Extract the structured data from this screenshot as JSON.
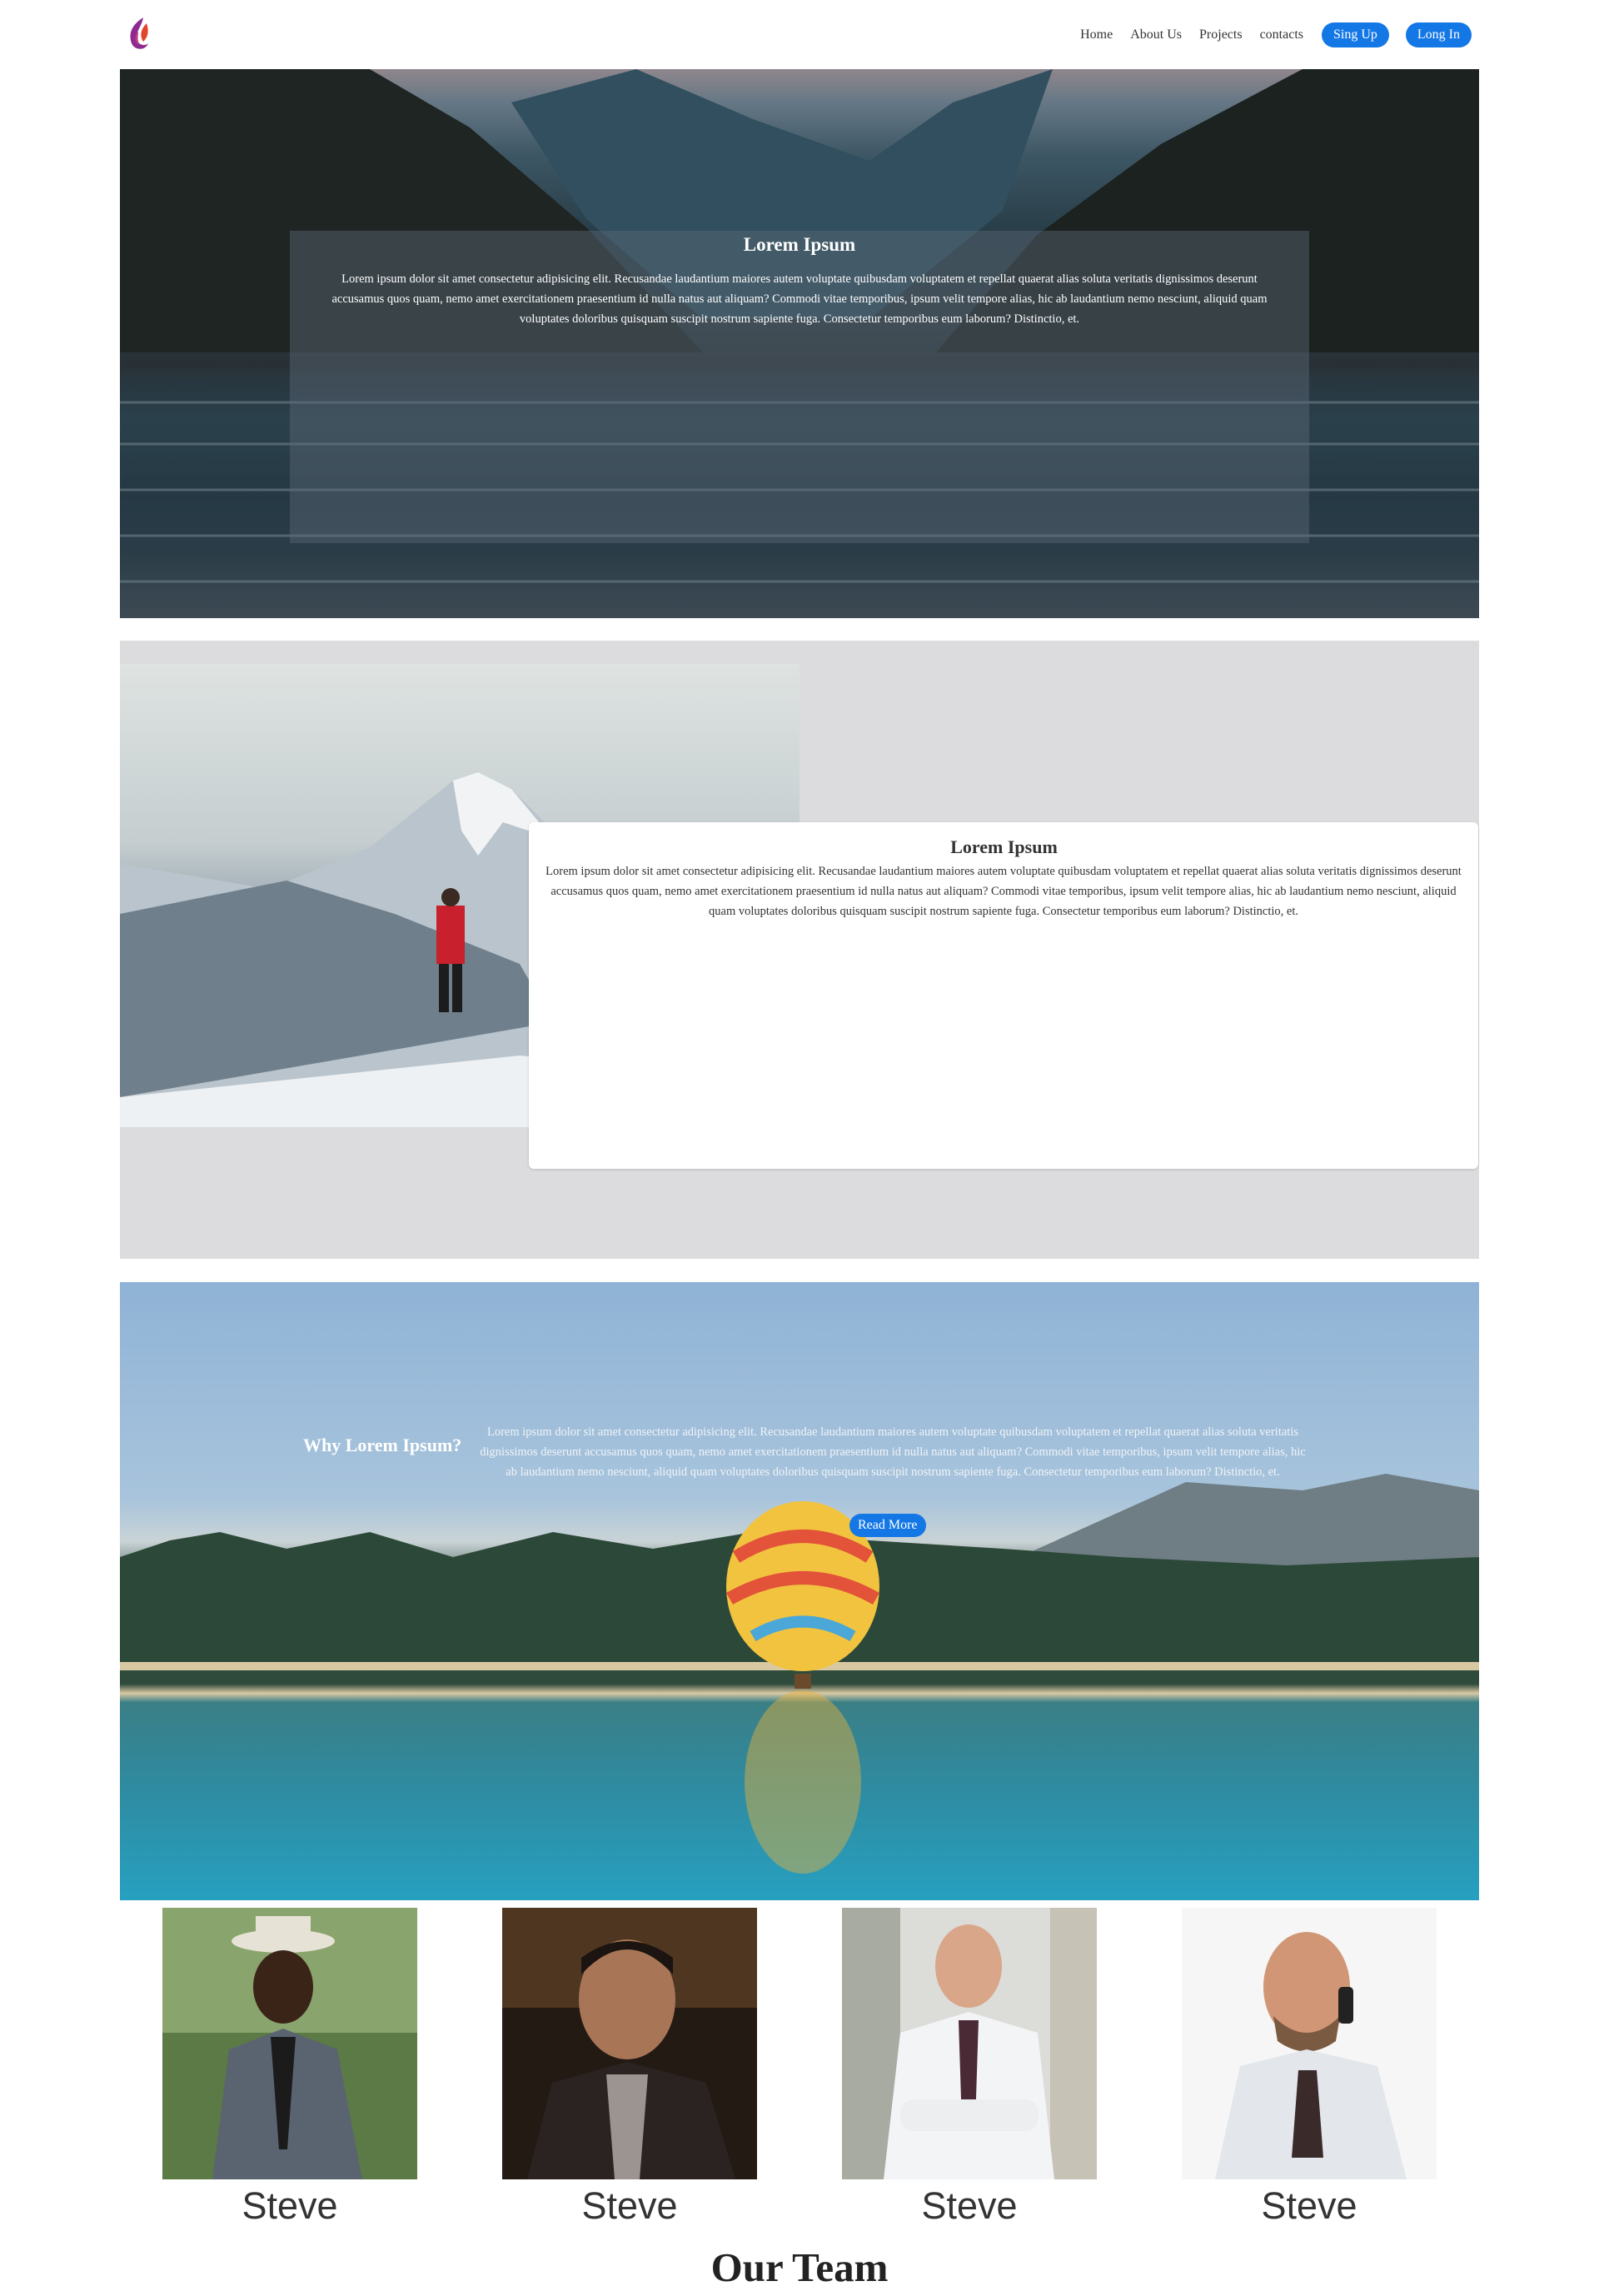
{
  "nav": {
    "logo_icon": "flame-logo-icon",
    "links": [
      "Home",
      "About Us",
      "Projects",
      "contacts"
    ],
    "signup_label": "Sing Up",
    "login_label": "Long In",
    "accent_color": "#1477e6"
  },
  "hero": {
    "title": "Lorem Ipsum",
    "text": "Lorem ipsum dolor sit amet consectetur adipisicing elit. Recusandae laudantium maiores autem voluptate quibusdam voluptatem et repellat quaerat alias soluta veritatis dignissimos deserunt accusamus quos quam, nemo amet exercitationem praesentium id nulla natus aut aliquam? Commodi vitae temporibus, ipsum velit tempore alias, hic ab laudantium nemo nesciunt, aliquid quam voluptates doloribus quisquam suscipit nostrum sapiente fuga. Consectetur temporibus eum laborum? Distinctio, et."
  },
  "about": {
    "title": "Lorem Ipsum",
    "text": "Lorem ipsum dolor sit amet consectetur adipisicing elit. Recusandae laudantium maiores autem voluptate quibusdam voluptatem et repellat quaerat alias soluta veritatis dignissimos deserunt accusamus quos quam, nemo amet exercitationem praesentium id nulla natus aut aliquam? Commodi vitae temporibus, ipsum velit tempore alias, hic ab laudantium nemo nesciunt, aliquid quam voluptates doloribus quisquam suscipit nostrum sapiente fuga. Consectetur temporibus eum laborum? Distinctio, et."
  },
  "why": {
    "title": "Why Lorem Ipsum?",
    "text": "Lorem ipsum dolor sit amet consectetur adipisicing elit. Recusandae laudantium maiores autem voluptate quibusdam voluptatem et repellat quaerat alias soluta veritatis dignissimos deserunt accusamus quos quam, nemo amet exercitationem praesentium id nulla natus aut aliquam? Commodi vitae temporibus, ipsum velit tempore alias, hic ab laudantium nemo nesciunt, aliquid quam voluptates doloribus quisquam suscipit nostrum sapiente fuga. Consectetur temporibus eum laborum? Distinctio, et.",
    "button_label": "Read More"
  },
  "team": {
    "heading": "Our Team",
    "members": [
      {
        "name": "Steve"
      },
      {
        "name": "Steve"
      },
      {
        "name": "Steve"
      },
      {
        "name": "Steve"
      }
    ]
  }
}
